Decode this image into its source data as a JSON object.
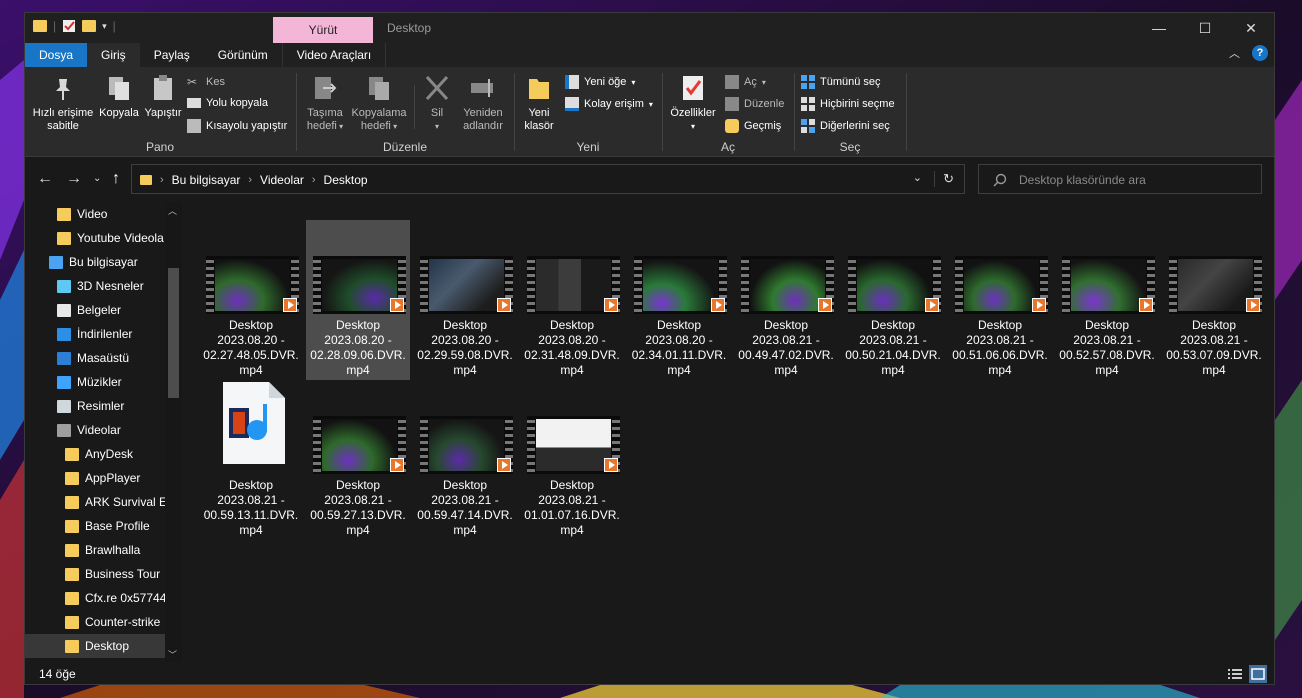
{
  "window": {
    "title": "Desktop",
    "context_tab": "Yürüt",
    "minimize": "—",
    "maximize": "☐",
    "close": "✕"
  },
  "tabs": [
    {
      "label": "Dosya"
    },
    {
      "label": "Giriş"
    },
    {
      "label": "Paylaş"
    },
    {
      "label": "Görünüm"
    },
    {
      "label": "Video Araçları"
    }
  ],
  "ribbon": {
    "pano": {
      "label": "Pano",
      "pin": "Hızlı erişime sabitle",
      "pin_l1": "Hızlı erişime",
      "pin_l2": "sabitle",
      "copy": "Kopyala",
      "paste": "Yapıştır",
      "cut": "Kes",
      "copy_path": "Yolu kopyala",
      "paste_shortcut": "Kısayolu yapıştır"
    },
    "duzenle": {
      "label": "Düzenle",
      "move_l1": "Taşıma",
      "move_l2": "hedefi",
      "copyto_l1": "Kopyalama",
      "copyto_l2": "hedefi",
      "delete": "Sil",
      "rename_l1": "Yeniden",
      "rename_l2": "adlandır"
    },
    "yeni": {
      "label": "Yeni",
      "folder_l1": "Yeni",
      "folder_l2": "klasör",
      "new_item": "Yeni öğe",
      "easy_access": "Kolay erişim"
    },
    "ac": {
      "label": "Aç",
      "properties": "Özellikler",
      "open": "Aç",
      "edit": "Düzenle",
      "history": "Geçmiş"
    },
    "sec": {
      "label": "Seç",
      "select_all": "Tümünü seç",
      "select_none": "Hiçbirini seçme",
      "invert": "Diğerlerini seç"
    }
  },
  "address": {
    "crumbs": [
      "Bu bilgisayar",
      "Videolar",
      "Desktop"
    ],
    "search_placeholder": "Desktop klasöründe ara"
  },
  "nav_pane": [
    {
      "label": "Video",
      "icon": "folder-icon"
    },
    {
      "label": "Youtube Videola",
      "icon": "folder-icon"
    },
    {
      "label": "Bu bilgisayar",
      "icon": "computer-icon"
    },
    {
      "label": "3D Nesneler",
      "icon": "3d-objects-icon"
    },
    {
      "label": "Belgeler",
      "icon": "documents-icon"
    },
    {
      "label": "İndirilenler",
      "icon": "downloads-icon"
    },
    {
      "label": "Masaüstü",
      "icon": "desktop-icon"
    },
    {
      "label": "Müzikler",
      "icon": "music-icon"
    },
    {
      "label": "Resimler",
      "icon": "pictures-icon"
    },
    {
      "label": "Videolar",
      "icon": "videos-icon"
    },
    {
      "label": "AnyDesk",
      "icon": "folder-icon"
    },
    {
      "label": "AppPlayer",
      "icon": "folder-icon"
    },
    {
      "label": "ARK  Survival E",
      "icon": "folder-icon"
    },
    {
      "label": "Base Profile",
      "icon": "folder-icon"
    },
    {
      "label": "Brawlhalla",
      "icon": "folder-icon"
    },
    {
      "label": "Business Tour",
      "icon": "folder-icon"
    },
    {
      "label": "Cfx.re  0x57744",
      "icon": "folder-icon"
    },
    {
      "label": "Counter-strike",
      "icon": "folder-icon"
    },
    {
      "label": "Desktop",
      "icon": "folder-icon"
    }
  ],
  "files": [
    {
      "l1": "Desktop",
      "l2": "2023.08.20 -",
      "l3": "02.27.48.05.DVR.",
      "l4": "mp4"
    },
    {
      "l1": "Desktop",
      "l2": "2023.08.20 -",
      "l3": "02.28.09.06.DVR.",
      "l4": "mp4"
    },
    {
      "l1": "Desktop",
      "l2": "2023.08.20 -",
      "l3": "02.29.59.08.DVR.",
      "l4": "mp4"
    },
    {
      "l1": "Desktop",
      "l2": "2023.08.20 -",
      "l3": "02.31.48.09.DVR.",
      "l4": "mp4"
    },
    {
      "l1": "Desktop",
      "l2": "2023.08.20 -",
      "l3": "02.34.01.11.DVR.",
      "l4": "mp4"
    },
    {
      "l1": "Desktop",
      "l2": "2023.08.21 -",
      "l3": "00.49.47.02.DVR.",
      "l4": "mp4"
    },
    {
      "l1": "Desktop",
      "l2": "2023.08.21 -",
      "l3": "00.50.21.04.DVR.",
      "l4": "mp4"
    },
    {
      "l1": "Desktop",
      "l2": "2023.08.21 -",
      "l3": "00.51.06.06.DVR.",
      "l4": "mp4"
    },
    {
      "l1": "Desktop",
      "l2": "2023.08.21 -",
      "l3": "00.52.57.08.DVR.",
      "l4": "mp4"
    },
    {
      "l1": "Desktop",
      "l2": "2023.08.21 -",
      "l3": "00.53.07.09.DVR.",
      "l4": "mp4"
    },
    {
      "l1": "Desktop",
      "l2": "2023.08.21 -",
      "l3": "00.59.13.11.DVR.",
      "l4": "mp4"
    },
    {
      "l1": "Desktop",
      "l2": "2023.08.21 -",
      "l3": "00.59.27.13.DVR.",
      "l4": "mp4"
    },
    {
      "l1": "Desktop",
      "l2": "2023.08.21 -",
      "l3": "00.59.47.14.DVR.",
      "l4": "mp4"
    },
    {
      "l1": "Desktop",
      "l2": "2023.08.21 -",
      "l3": "01.01.07.16.DVR.",
      "l4": "mp4"
    }
  ],
  "status": {
    "count": "14 öğe"
  }
}
